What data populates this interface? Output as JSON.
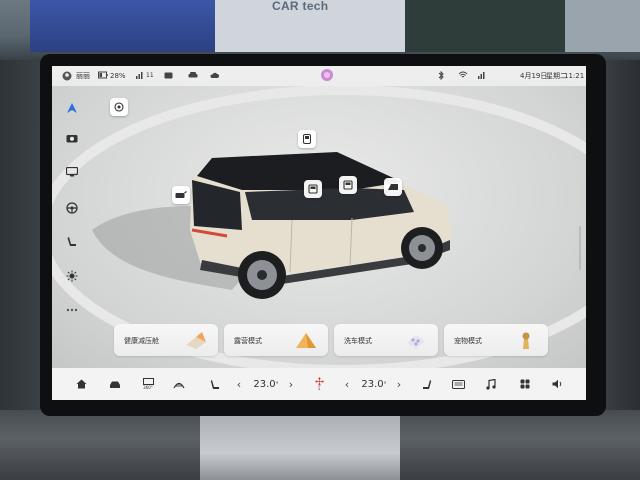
{
  "background": {
    "sign_text": "CAR tech"
  },
  "status_bar": {
    "user_name": "丽丽",
    "battery": "28%",
    "signal_count": "11",
    "date": "4月19日",
    "weekday": "星期二",
    "time": "11:21"
  },
  "sidebar": {
    "items": [
      {
        "icon": "navigation-arrow-icon"
      },
      {
        "icon": "camera-icon"
      },
      {
        "icon": "screen-icon"
      },
      {
        "icon": "steering-wheel-icon"
      },
      {
        "icon": "seat-icon"
      },
      {
        "icon": "light-icon"
      },
      {
        "icon": "more-icon"
      }
    ]
  },
  "markers": [
    {
      "icon": "sunroof-icon"
    },
    {
      "icon": "sentry-camera-icon"
    },
    {
      "icon": "front-door-icon"
    },
    {
      "icon": "rear-door-icon"
    },
    {
      "icon": "window-icon"
    },
    {
      "icon": "tailgate-icon"
    }
  ],
  "modes": [
    {
      "label": "健康减压舱",
      "icon": "wellness-pod-icon"
    },
    {
      "label": "露营模式",
      "icon": "tent-icon"
    },
    {
      "label": "洗车模式",
      "icon": "car-wash-icon"
    },
    {
      "label": "宠物模式",
      "icon": "pet-icon"
    }
  ],
  "dock": {
    "fan_speed_label": "1",
    "left_temp": "23.0",
    "right_temp": "23.0",
    "temp_unit": "°",
    "defrost_label": "360°",
    "icons": [
      "home-icon",
      "car-icon",
      "rear-defrost-icon",
      "front-defrost-icon",
      "driver-seat-heat-icon",
      "fan-icon",
      "passenger-seat-heat-icon",
      "ac-icon",
      "music-icon",
      "apps-icon",
      "volume-icon"
    ]
  },
  "colors": {
    "accent_blue": "#2f6fe0",
    "car_body": "#e6dfcf",
    "car_roof": "#1c1d20",
    "dock_bg": "#f3f3f3"
  }
}
